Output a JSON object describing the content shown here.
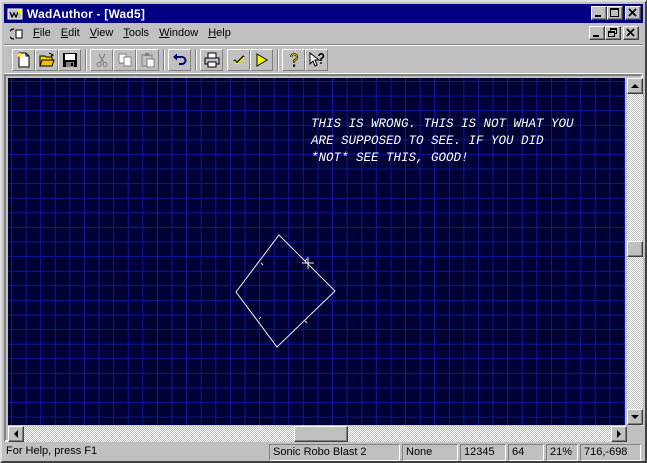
{
  "window": {
    "title": "WadAuthor - [Wad5]"
  },
  "menu": {
    "items": [
      {
        "pre": "",
        "ul": "F",
        "post": "ile"
      },
      {
        "pre": "",
        "ul": "E",
        "post": "dit"
      },
      {
        "pre": "",
        "ul": "V",
        "post": "iew"
      },
      {
        "pre": "",
        "ul": "T",
        "post": "ools"
      },
      {
        "pre": "",
        "ul": "W",
        "post": "indow"
      },
      {
        "pre": "",
        "ul": "H",
        "post": "elp"
      }
    ]
  },
  "toolbar": {
    "icons": [
      "new-file-icon",
      "open-folder-icon",
      "save-icon",
      "cut-icon",
      "copy-icon",
      "paste-icon",
      "undo-icon",
      "print-icon",
      "check-icon",
      "run-icon",
      "help-icon",
      "context-help-icon"
    ]
  },
  "canvas": {
    "message_line1": "THIS IS WRONG. THIS IS NOT WHAT YOU",
    "message_line2": "ARE SUPPOSED TO SEE. IF YOU DID",
    "message_line3": "*NOT* SEE THIS, GOOD!",
    "colors": {
      "background": "#000034",
      "grid": "#0c1a9e",
      "lines": "#ffffff"
    }
  },
  "status": {
    "help_text": "For Help, press F1",
    "game": "Sonic Robo Blast 2",
    "mode": "None",
    "value": "12345",
    "grid_size": "64",
    "zoom": "21%",
    "coordinates": "716,-698"
  }
}
